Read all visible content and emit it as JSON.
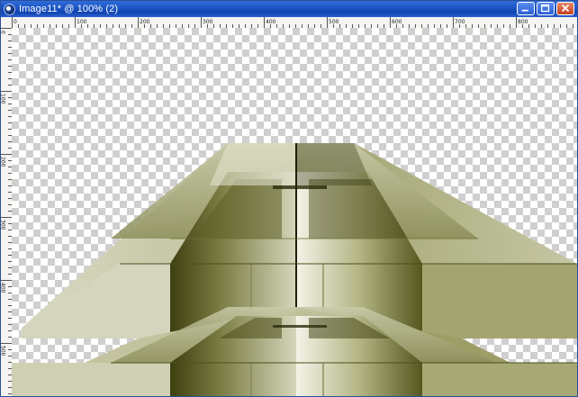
{
  "window": {
    "title": "Image11* @ 100% (2)",
    "app_icon": "paint-app-icon",
    "controls": [
      {
        "name": "minimize-button",
        "icon": "minimize-icon"
      },
      {
        "name": "maximize-button",
        "icon": "maximize-icon"
      },
      {
        "name": "close-button",
        "icon": "close-icon"
      }
    ]
  },
  "ruler": {
    "top_labels": [
      "0",
      "100",
      "200",
      "300",
      "400",
      "500",
      "600",
      "700",
      "800"
    ],
    "left_labels": [
      "0",
      "100",
      "200",
      "300",
      "400",
      "500"
    ]
  },
  "canvas": {
    "background": "transparency-checkerboard",
    "colors": {
      "light": "#d6d7bd",
      "mid": "#a9ab7c",
      "dark": "#5c5e24",
      "darkest": "#2a2a0a"
    }
  }
}
